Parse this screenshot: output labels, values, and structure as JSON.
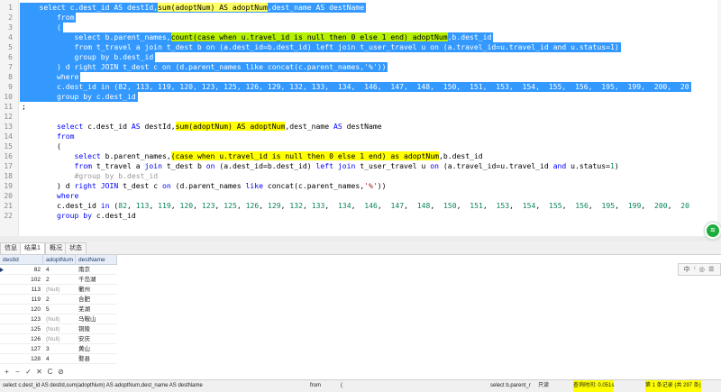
{
  "editor": {
    "lines": [
      {
        "n": "1",
        "sel": true,
        "parts": [
          [
            "",
            "    select c.dest_id AS destId,"
          ],
          [
            "hl",
            "sum(adoptNum) AS adoptNum"
          ],
          [
            "",
            ",dest_name AS destName"
          ]
        ]
      },
      {
        "n": "2",
        "sel": true,
        "parts": [
          [
            "",
            "        from"
          ]
        ]
      },
      {
        "n": "3",
        "sel": true,
        "parts": [
          [
            "",
            "        ("
          ]
        ]
      },
      {
        "n": "4",
        "sel": true,
        "parts": [
          [
            "",
            "            select b.parent_names,"
          ],
          [
            "hlg",
            "count(case when u.travel_id is null then 0 else 1 end) adoptNum"
          ],
          [
            "",
            ",b.dest_id"
          ]
        ]
      },
      {
        "n": "5",
        "sel": true,
        "parts": [
          [
            "",
            "            from t_travel a join t_dest b on (a.dest_id=b.dest_id) left join t_user_travel u on (a.travel_id=u.travel_id and u.status=1)"
          ]
        ]
      },
      {
        "n": "6",
        "sel": true,
        "parts": [
          [
            "",
            "            group by b.dest_id"
          ]
        ]
      },
      {
        "n": "7",
        "sel": true,
        "parts": [
          [
            "",
            "        ) d right JOIN t_dest c on (d.parent_names like concat(c.parent_names,'%'))"
          ]
        ]
      },
      {
        "n": "8",
        "sel": true,
        "parts": [
          [
            "",
            "        where"
          ]
        ]
      },
      {
        "n": "9",
        "sel": true,
        "parts": [
          [
            "",
            "        c.dest_id in (82, 113, 119, 120, 123, 125, 126, 129, 132, 133,  134,  146,  147,  148,  150,  151,  153,  154,  155,  156,  195,  199,  200,  20"
          ]
        ]
      },
      {
        "n": "10",
        "sel": true,
        "parts": [
          [
            "",
            "        group by c.dest_id"
          ]
        ]
      },
      {
        "n": "11",
        "sel": false,
        "parts": [
          [
            "",
            ";"
          ]
        ]
      },
      {
        "n": "12",
        "sel": false,
        "parts": [
          [
            "",
            ""
          ]
        ]
      },
      {
        "n": "13",
        "sel": false,
        "parts": [
          [
            "",
            "        "
          ],
          [
            "kw",
            "select"
          ],
          [
            "",
            " c.dest_id "
          ],
          [
            "kw",
            "AS"
          ],
          [
            "",
            " destId,"
          ],
          [
            "hl",
            "sum(adoptNum) AS adoptNum"
          ],
          [
            "",
            ",dest_name "
          ],
          [
            "kw",
            "AS"
          ],
          [
            "",
            " destName"
          ]
        ]
      },
      {
        "n": "14",
        "sel": false,
        "parts": [
          [
            "",
            "        "
          ],
          [
            "kw",
            "from"
          ]
        ]
      },
      {
        "n": "15",
        "sel": false,
        "parts": [
          [
            "",
            "        ("
          ]
        ]
      },
      {
        "n": "16",
        "sel": false,
        "parts": [
          [
            "",
            "            "
          ],
          [
            "kw",
            "select"
          ],
          [
            "",
            " b.parent_names,"
          ],
          [
            "hl",
            "(case when u.travel_id is null then 0 else 1 end) as adoptNum"
          ],
          [
            "",
            ",b.dest_id"
          ]
        ]
      },
      {
        "n": "17",
        "sel": false,
        "parts": [
          [
            "",
            "            "
          ],
          [
            "kw",
            "from"
          ],
          [
            "",
            " t_travel a "
          ],
          [
            "kw",
            "join"
          ],
          [
            "",
            " t_dest b "
          ],
          [
            "kw",
            "on"
          ],
          [
            "",
            " (a.dest_id=b.dest_id) "
          ],
          [
            "kw",
            "left join"
          ],
          [
            "",
            " t_user_travel u "
          ],
          [
            "kw",
            "on"
          ],
          [
            "",
            " (a.travel_id=u.travel_id "
          ],
          [
            "kw",
            "and"
          ],
          [
            "",
            " u.status="
          ],
          [
            "num",
            "1"
          ],
          [
            "",
            ")"
          ]
        ]
      },
      {
        "n": "18",
        "sel": false,
        "parts": [
          [
            "",
            "            "
          ],
          [
            "cmt",
            "#group by b.dest_id"
          ]
        ]
      },
      {
        "n": "19",
        "sel": false,
        "parts": [
          [
            "",
            "        ) d "
          ],
          [
            "kw",
            "right JOIN"
          ],
          [
            "",
            " t_dest c "
          ],
          [
            "kw",
            "on"
          ],
          [
            "",
            " (d.parent_names "
          ],
          [
            "kw",
            "like"
          ],
          [
            "",
            " concat(c.parent_names,"
          ],
          [
            "str",
            "'%'"
          ],
          [
            "",
            "))"
          ]
        ]
      },
      {
        "n": "20",
        "sel": false,
        "parts": [
          [
            "",
            "        "
          ],
          [
            "kw",
            "where"
          ]
        ]
      },
      {
        "n": "21",
        "sel": false,
        "parts": [
          [
            "",
            "        c.dest_id "
          ],
          [
            "kw",
            "in"
          ],
          [
            "",
            " ("
          ],
          [
            "num",
            "82"
          ],
          [
            "",
            ", "
          ],
          [
            "num",
            "113"
          ],
          [
            "",
            ", "
          ],
          [
            "num",
            "119"
          ],
          [
            "",
            ", "
          ],
          [
            "num",
            "120"
          ],
          [
            "",
            ", "
          ],
          [
            "num",
            "123"
          ],
          [
            "",
            ", "
          ],
          [
            "num",
            "125"
          ],
          [
            "",
            ", "
          ],
          [
            "num",
            "126"
          ],
          [
            "",
            ", "
          ],
          [
            "num",
            "129"
          ],
          [
            "",
            ", "
          ],
          [
            "num",
            "132"
          ],
          [
            "",
            ", "
          ],
          [
            "num",
            "133"
          ],
          [
            "",
            ",  "
          ],
          [
            "num",
            "134"
          ],
          [
            "",
            ",  "
          ],
          [
            "num",
            "146"
          ],
          [
            "",
            ",  "
          ],
          [
            "num",
            "147"
          ],
          [
            "",
            ",  "
          ],
          [
            "num",
            "148"
          ],
          [
            "",
            ",  "
          ],
          [
            "num",
            "150"
          ],
          [
            "",
            ",  "
          ],
          [
            "num",
            "151"
          ],
          [
            "",
            ",  "
          ],
          [
            "num",
            "153"
          ],
          [
            "",
            ",  "
          ],
          [
            "num",
            "154"
          ],
          [
            "",
            ",  "
          ],
          [
            "num",
            "155"
          ],
          [
            "",
            ",  "
          ],
          [
            "num",
            "156"
          ],
          [
            "",
            ",  "
          ],
          [
            "num",
            "195"
          ],
          [
            "",
            ",  "
          ],
          [
            "num",
            "199"
          ],
          [
            "",
            ",  "
          ],
          [
            "num",
            "200"
          ],
          [
            "",
            ",  "
          ],
          [
            "num",
            "20"
          ]
        ]
      },
      {
        "n": "22",
        "sel": false,
        "parts": [
          [
            "",
            "        "
          ],
          [
            "kw",
            "group by"
          ],
          [
            "",
            " c.dest_id"
          ]
        ]
      }
    ]
  },
  "tabs": [
    "信息",
    "结果1",
    "概况",
    "状态"
  ],
  "grid": {
    "headers": [
      "destId",
      "adoptNum",
      "destName"
    ],
    "rows": [
      {
        "id": "82",
        "num": "4",
        "name": "南京"
      },
      {
        "id": "102",
        "num": "2",
        "name": "千岛湖"
      },
      {
        "id": "113",
        "num": "(Null)",
        "name": "衢州"
      },
      {
        "id": "119",
        "num": "2",
        "name": "合肥"
      },
      {
        "id": "120",
        "num": "5",
        "name": "芜湖"
      },
      {
        "id": "123",
        "num": "(Null)",
        "name": "马鞍山"
      },
      {
        "id": "125",
        "num": "(Null)",
        "name": "铜陵"
      },
      {
        "id": "126",
        "num": "(Null)",
        "name": "安庆"
      },
      {
        "id": "127",
        "num": "3",
        "name": "黄山"
      },
      {
        "id": "128",
        "num": "4",
        "name": "婺县"
      }
    ]
  },
  "toolbar": [
    "+",
    "−",
    "✓",
    "✕",
    "C",
    "⊘"
  ],
  "status": {
    "sql": "select c.dest_id AS destId,sum(adoptNum) AS adoptNum,dest_name AS destName",
    "from": "from",
    "paren": "(",
    "sub": "select b.parent_r",
    "readonly": "只读",
    "time": "查询时间: 0.051s",
    "records": "第 1 条记录 (共 297 条)"
  },
  "ime": "中 ⁾ ◎ ☰"
}
